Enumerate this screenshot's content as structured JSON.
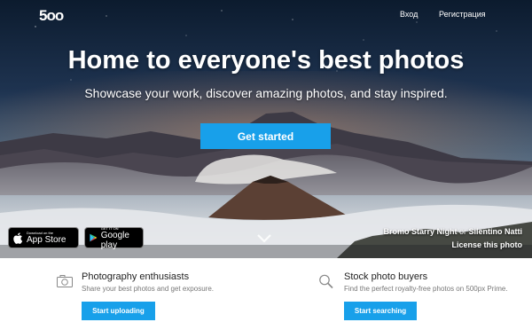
{
  "header": {
    "logo": "5oo",
    "login": "Вход",
    "register": "Регистрация"
  },
  "hero": {
    "headline": "Home to everyone's best photos",
    "subhead": "Showcase your work, discover amazing photos, and stay inspired.",
    "cta": "Get started"
  },
  "app_badges": {
    "apple_small": "Download on the",
    "apple_big": "App Store",
    "google_small": "GET IT ON",
    "google_big": "Google play"
  },
  "credit": {
    "photo_title": "Bromo Starry Night",
    "or": " or ",
    "photographer": "Silentino Natti",
    "license": "License this photo"
  },
  "features": [
    {
      "icon": "camera-icon",
      "title": "Photography enthusiasts",
      "desc": "Share your best photos and get exposure.",
      "button": "Start uploading"
    },
    {
      "icon": "search-icon",
      "title": "Stock photo buyers",
      "desc": "Find the perfect royalty-free photos on 500px Prime.",
      "button": "Start searching"
    }
  ],
  "colors": {
    "accent": "#18a0ea"
  }
}
